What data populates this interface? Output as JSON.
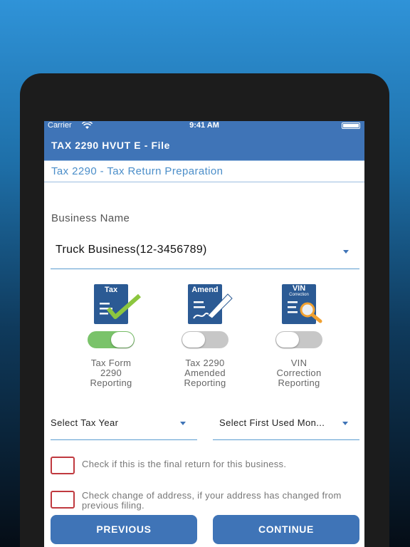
{
  "status_bar": {
    "carrier": "Carrier",
    "time": "9:41 AM"
  },
  "nav": {
    "title": "TAX 2290 HVUT E - File"
  },
  "subheader": {
    "title": "Tax 2290 - Tax Return Preparation"
  },
  "business": {
    "label": "Business Name",
    "selected": "Truck Business(12-3456789)"
  },
  "options": [
    {
      "icon_label": "Tax",
      "icon": "tax-form-check-icon",
      "enabled": true,
      "line1": "Tax Form",
      "line2": "2290",
      "line3": "Reporting"
    },
    {
      "icon_label": "Amend",
      "icon": "amend-pen-icon",
      "enabled": false,
      "line1": "Tax 2290",
      "line2": "Amended",
      "line3": "Reporting"
    },
    {
      "icon_label": "VIN",
      "icon_sublabel": "Correction",
      "icon": "vin-magnifier-icon",
      "enabled": false,
      "line1": "VIN",
      "line2": "Correction",
      "line3": "Reporting"
    }
  ],
  "selects": {
    "tax_year": "Select Tax Year",
    "first_used_month": "Select First Used Mon..."
  },
  "checks": {
    "final_return": "Check if this is the final return for this business.",
    "change_address": "Check change of address, if your address has changed from previous filing."
  },
  "buttons": {
    "previous": "PREVIOUS",
    "continue": "CONTINUE"
  },
  "colors": {
    "primary": "#3f74b7",
    "toggle_on": "#7ac36a",
    "checkbox_border": "#c0393f",
    "icon_doc": "#2b5a94",
    "check_green": "#8cc63f",
    "magnifier_orange": "#f0a030"
  }
}
